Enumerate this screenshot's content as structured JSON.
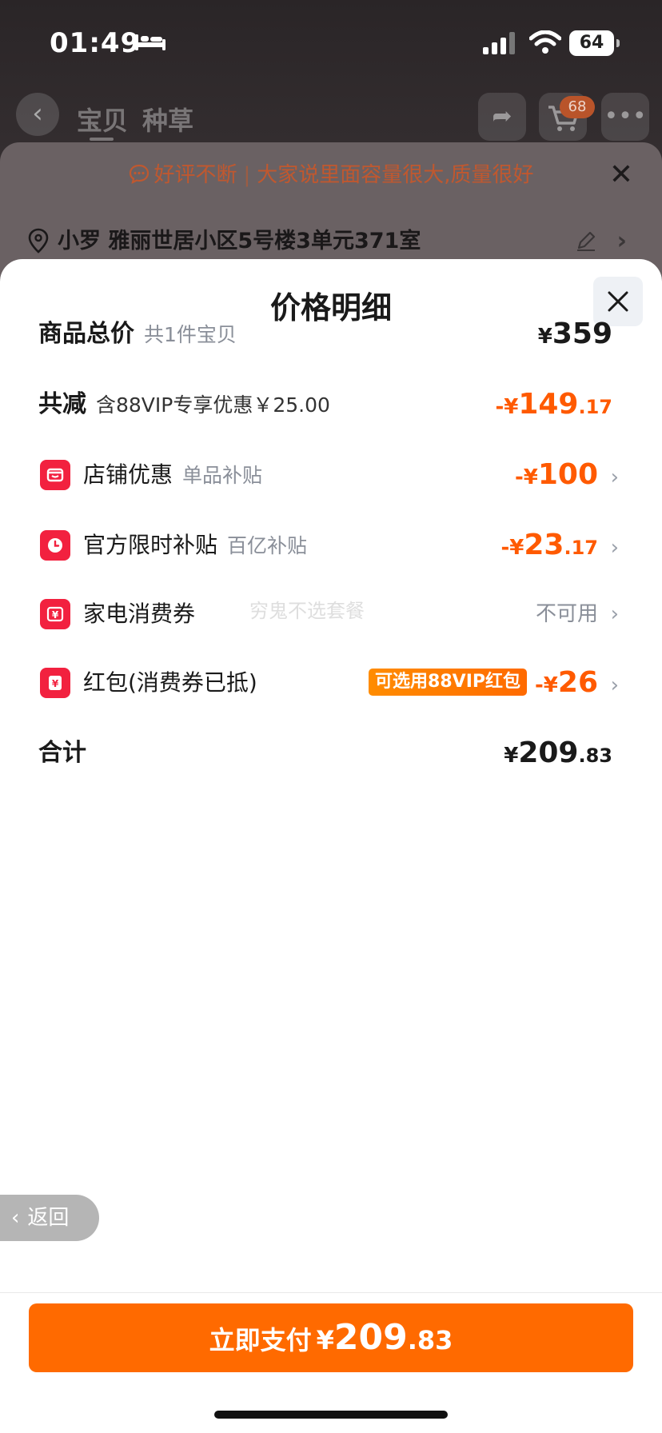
{
  "status_bar": {
    "time": "01:49",
    "battery": "64"
  },
  "nav": {
    "tab1": "宝贝",
    "tab2": "种草",
    "cart_badge": "68"
  },
  "notice": {
    "part1": "好评不断",
    "part2": "大家说里面容量很大,质量很好"
  },
  "address": {
    "text": "小罗  雅丽世居小区5号楼3单元371室"
  },
  "sheet": {
    "title": "价格明细",
    "rows": {
      "total": {
        "title": "商品总价",
        "sub": "共1件宝贝",
        "cur": "¥",
        "int": "359"
      },
      "reduce": {
        "title": "共减",
        "sub": "含88VIP专享优惠￥25.00",
        "cur": "-¥",
        "int": "149",
        "dec": ".17"
      },
      "shop": {
        "title": "店铺优惠",
        "sub": "单品补贴",
        "cur": "-¥",
        "int": "100"
      },
      "official": {
        "title": "官方限时补贴",
        "sub": "百亿补贴",
        "cur": "-¥",
        "int": "23",
        "dec": ".17"
      },
      "appliance": {
        "title": "家电消费券",
        "status": "不可用"
      },
      "redpacket": {
        "title": "红包(消费券已抵)",
        "tag": "可选用88VIP红包",
        "cur": "-¥",
        "int": "26"
      },
      "sum": {
        "title": "合计",
        "cur": "¥",
        "int": "209",
        "dec": ".83"
      }
    },
    "watermark": "穷鬼不选套餐"
  },
  "back": {
    "label": "返回"
  },
  "pay": {
    "label": "立即支付",
    "cur": "¥",
    "int": "209",
    "dec": ".83"
  },
  "colors": {
    "accent": "#ff6a00",
    "price_orange": "#ff5a00",
    "icon_red": "#f2213f"
  },
  "icons": [
    "bed-icon",
    "signal-icon",
    "wifi-icon",
    "battery-icon",
    "back-icon",
    "share-icon",
    "cart-icon",
    "more-icon",
    "chat-icon",
    "close-icon",
    "location-pin-icon",
    "edit-icon",
    "chevron-right-icon",
    "shop-icon",
    "clock-icon",
    "yen-coupon-icon",
    "yen-redpacket-icon",
    "chevron-left-icon"
  ]
}
